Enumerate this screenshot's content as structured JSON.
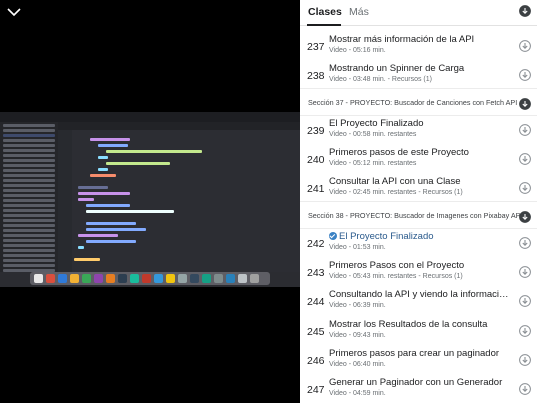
{
  "tabs": [
    {
      "label": "Clases",
      "active": true
    },
    {
      "label": "Más",
      "active": false
    }
  ],
  "lectures_a": [
    {
      "num": "237",
      "title": "Mostrar más información de la API",
      "meta": "Video - 05:16 min."
    },
    {
      "num": "238",
      "title": "Mostrando un Spinner de Carga",
      "meta": "Video - 03:48 min. - Recursos (1)"
    }
  ],
  "section_37": "Sección 37 - PROYECTO: Buscador de Canciones con Fetch API",
  "lectures_b": [
    {
      "num": "239",
      "title": "El Proyecto Finalizado",
      "meta": "Video - 00:58 min. restantes"
    },
    {
      "num": "240",
      "title": "Primeros pasos de este Proyecto",
      "meta": "Video - 05:12 min. restantes"
    },
    {
      "num": "241",
      "title": "Consultar la API con una Clase",
      "meta": "Video - 02:45 min. restantes - Recursos (1)"
    }
  ],
  "section_38": "Sección 38 - PROYECTO: Buscador de Imagenes con Pixabay API",
  "lectures_c": [
    {
      "num": "242",
      "title": "El Proyecto Finalizado",
      "meta": "Video - 01:53 min."
    },
    {
      "num": "243",
      "title": "Primeros Pasos con el Proyecto",
      "meta": "Video - 05:43 min. restantes - Recursos (1)"
    },
    {
      "num": "244",
      "title": "Consultando la API y viendo la información dis...",
      "meta": "Video - 06:39 min."
    },
    {
      "num": "245",
      "title": "Mostrar los Resultados de la consulta",
      "meta": "Video - 09:43 min."
    },
    {
      "num": "246",
      "title": "Primeros pasos para crear un paginador",
      "meta": "Video - 06:40 min."
    },
    {
      "num": "247",
      "title": "Generar un Paginador con un Generador",
      "meta": "Video - 04:59 min."
    }
  ],
  "colors": {
    "panel_bg": "#ffffff",
    "text_primary": "#1c1d1f",
    "text_secondary": "#6a6f73",
    "check_blue": "#3b82c4",
    "player_bg": "#000000"
  },
  "icons": {
    "collapse": "chevron-down-icon",
    "download": "download-circle-icon",
    "completed": "check-circle-icon"
  }
}
